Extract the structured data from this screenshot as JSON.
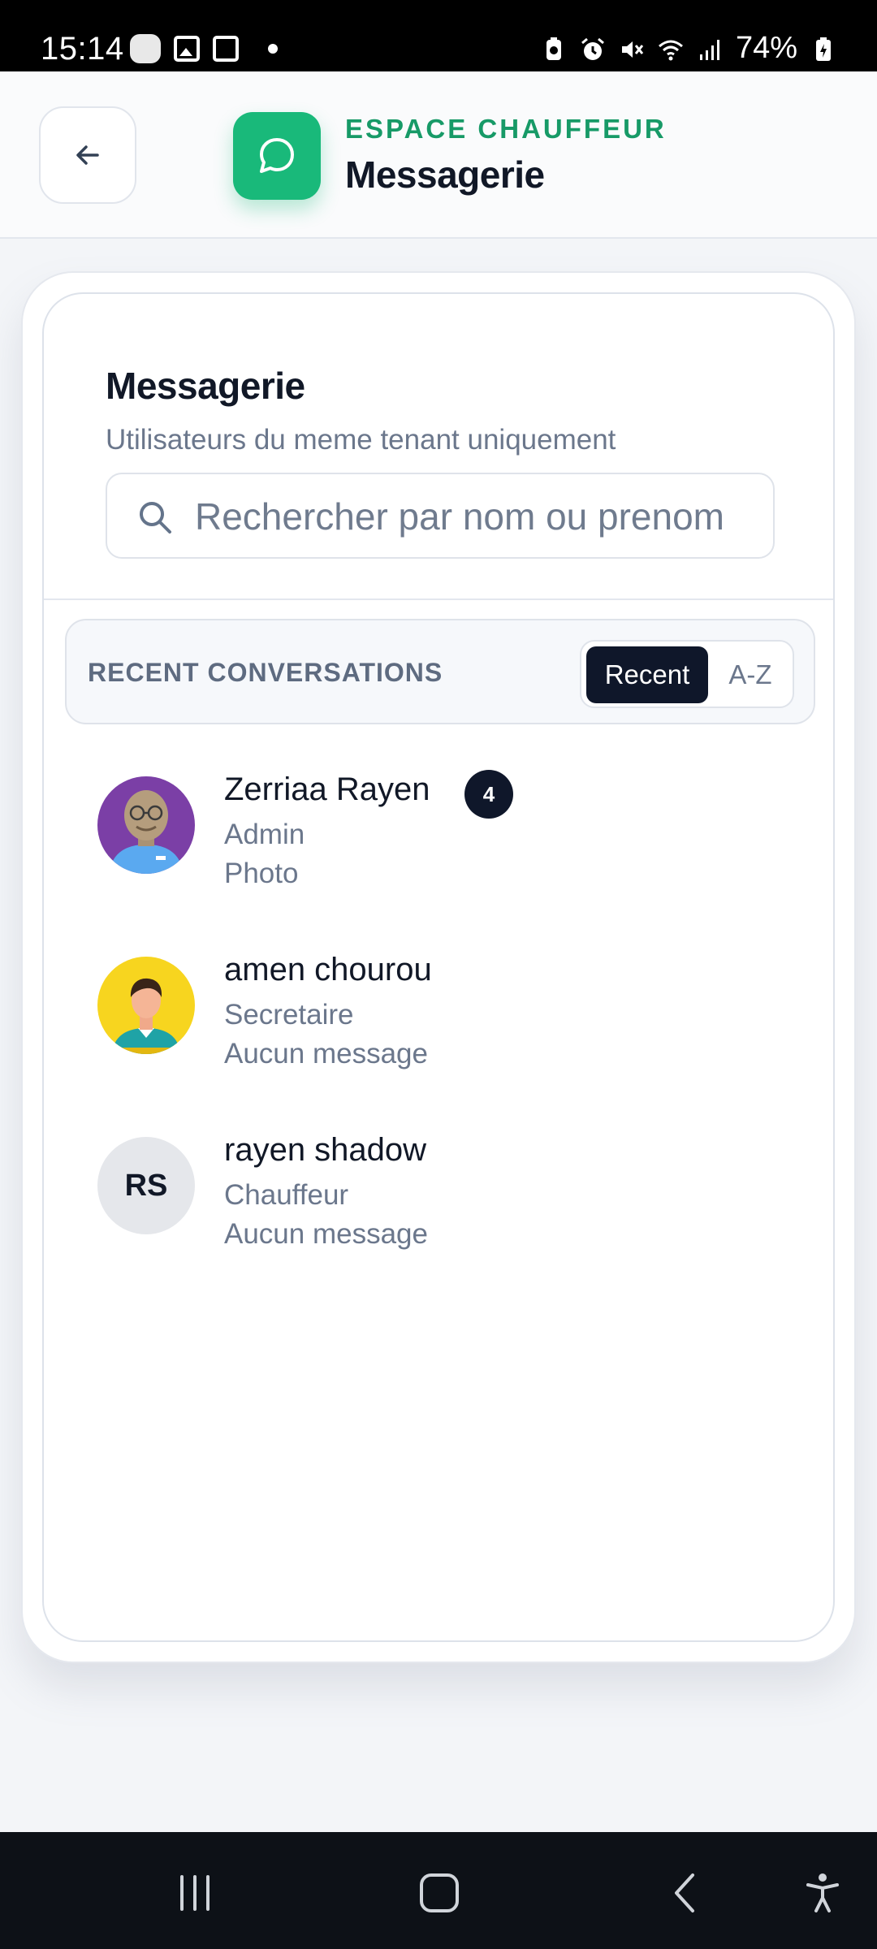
{
  "status_bar": {
    "time": "15:14",
    "battery": "74%"
  },
  "header": {
    "subtitle": "ESPACE CHAUFFEUR",
    "title": "Messagerie",
    "accent_color": "#19b97a"
  },
  "card": {
    "title": "Messagerie",
    "subtitle": "Utilisateurs du meme tenant uniquement",
    "search": {
      "placeholder": "Rechercher par nom ou prenom",
      "value": ""
    },
    "section_label": "RECENT CONVERSATIONS",
    "sort": {
      "recent_label": "Recent",
      "az_label": "A-Z",
      "selected": "Recent"
    }
  },
  "contacts": [
    {
      "name": "Zerriaa Rayen",
      "role": "Admin",
      "last_message": "Photo",
      "unread": "4",
      "avatar": "photo-bald-man-glasses"
    },
    {
      "name": "amen chourou",
      "role": "Secretaire",
      "last_message": "Aucun message",
      "avatar": "illustration-man-yellow"
    },
    {
      "name": "rayen shadow",
      "role": "Chauffeur",
      "last_message": "Aucun message",
      "initials": "RS"
    }
  ],
  "nav": {
    "icons": [
      "recents-icon",
      "home-icon",
      "back-icon",
      "accessibility-icon"
    ]
  }
}
